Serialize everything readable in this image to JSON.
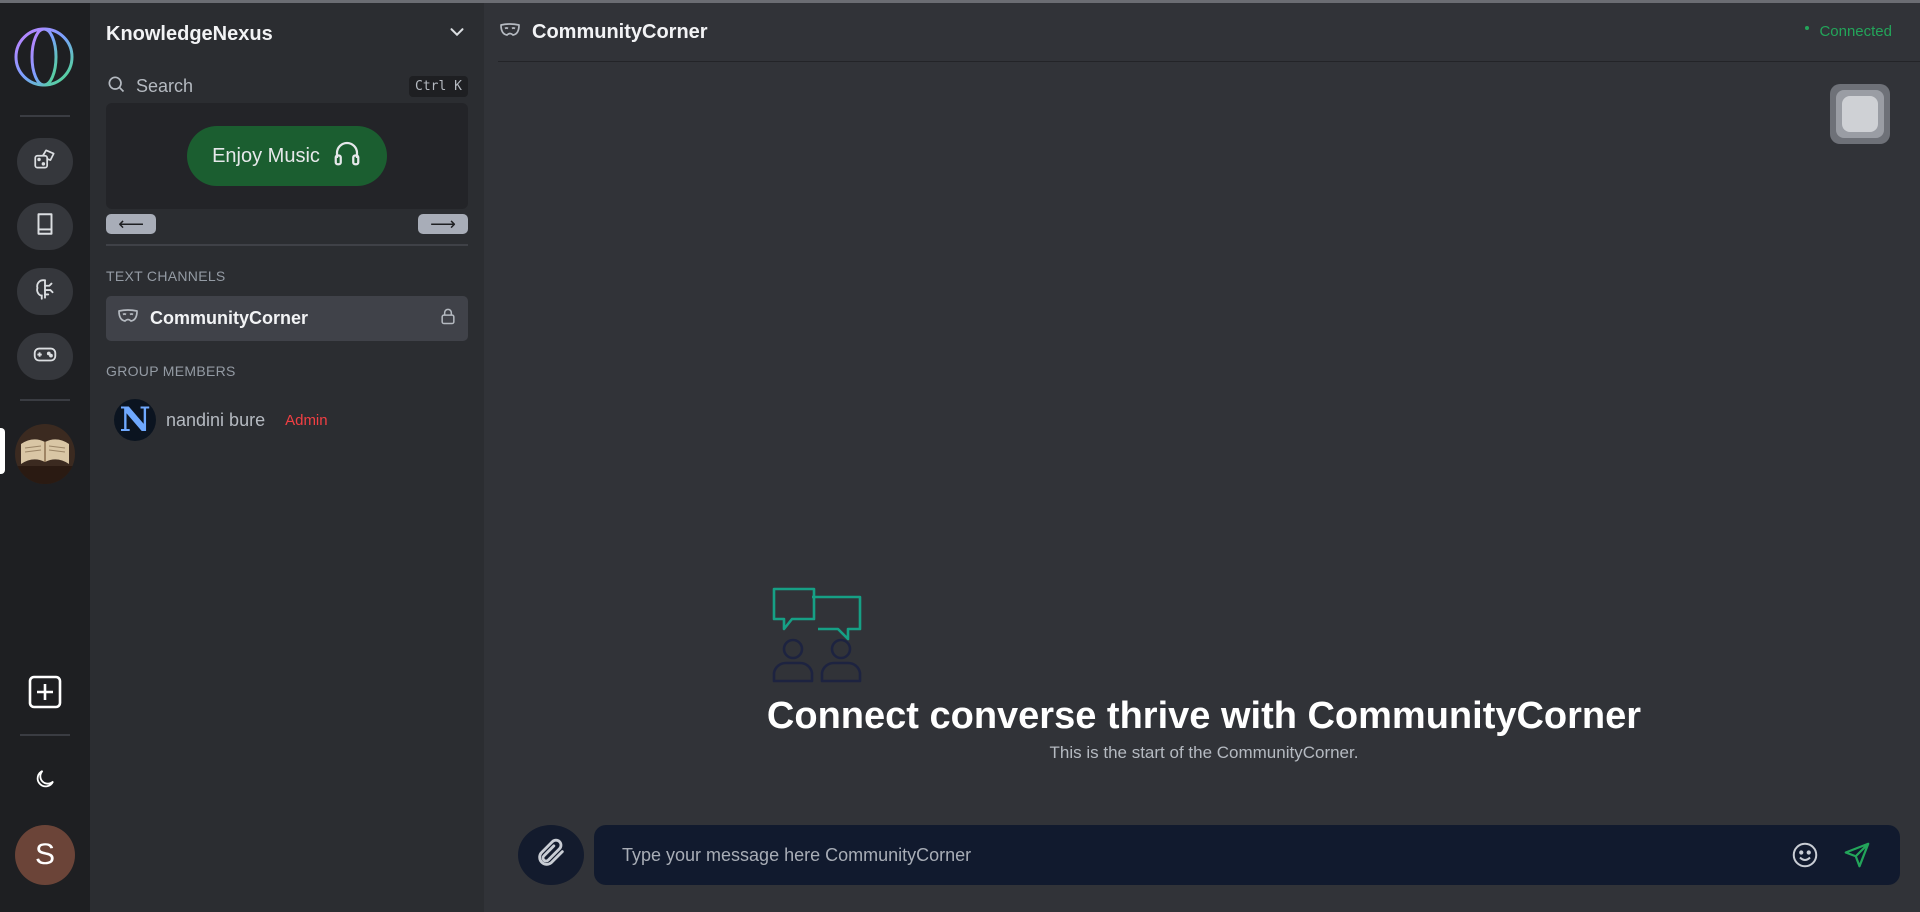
{
  "colors": {
    "accent_green": "#23a55a",
    "music_button": "#1b5e30",
    "admin_red": "#f23f43",
    "icon_teal": "#16a085",
    "icon_navy": "#1d2340"
  },
  "rail": {
    "icons": [
      "globe-logo-icon",
      "dice-icon",
      "book-icon",
      "brain-icon",
      "gamepad-icon",
      "plus-square-icon",
      "moon-icon"
    ],
    "user_initial": "S"
  },
  "sidebar": {
    "server_name": "KnowledgeNexus",
    "search": {
      "label": "Search",
      "shortcut": "Ctrl K"
    },
    "music": {
      "label": "Enjoy Music"
    },
    "nav": {
      "prev": "⟵",
      "next": "⟶"
    },
    "text_channels_label": "TEXT CHANNELS",
    "channel_name": "CommunityCorner",
    "group_members_label": "GROUP MEMBERS",
    "member": {
      "initial": "N",
      "name": "nandini bure",
      "role": "Admin"
    }
  },
  "main": {
    "channel_title": "CommunityCorner",
    "status": "Connected",
    "welcome_title": "Connect converse thrive with CommunityCorner",
    "welcome_subtitle": "This is the start of the CommunityCorner.",
    "message_placeholder": "Type your message here CommunityCorner"
  }
}
